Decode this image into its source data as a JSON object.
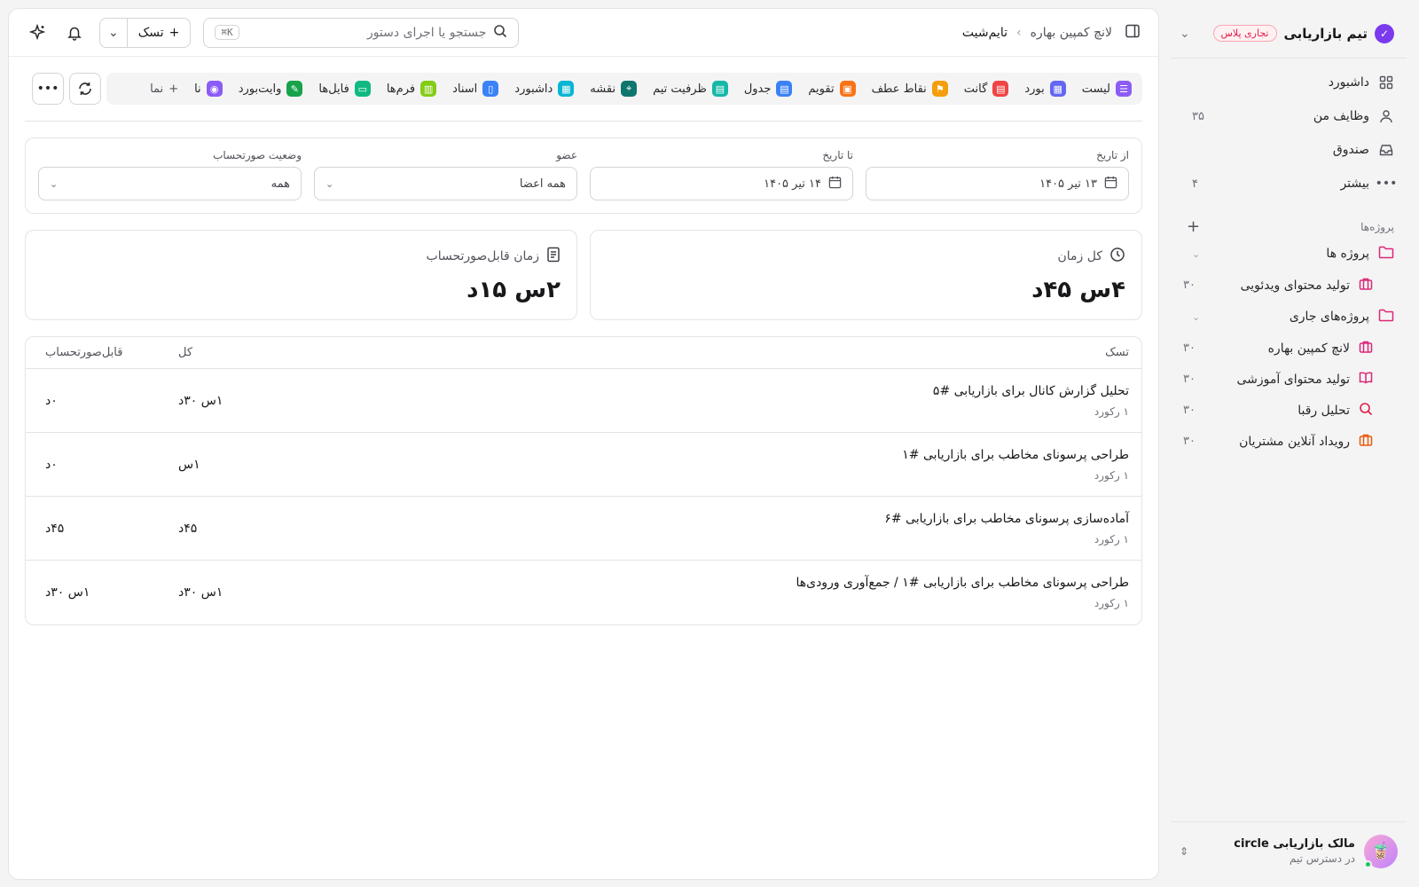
{
  "sidebar": {
    "workspace_name": "تیم بازاریابی",
    "plan_badge": "تجاری پلاس",
    "nav": [
      {
        "label": "داشبورد",
        "count": "",
        "icon": "grid-icon"
      },
      {
        "label": "وظایف من",
        "count": "۳۵",
        "icon": "user-icon"
      },
      {
        "label": "صندوق",
        "count": "",
        "icon": "inbox-icon"
      },
      {
        "label": "بیشتر",
        "count": "۴",
        "icon": "more-icon"
      }
    ],
    "projects_label": "پروژه‌ها",
    "folders": [
      {
        "label": "پروژه ها",
        "projects": [
          {
            "label": "تولید محتوای ویدئویی",
            "count": "۳۰",
            "color": "#db2777"
          }
        ]
      },
      {
        "label": "پروژه‌های جاری",
        "projects": [
          {
            "label": "لانچ کمپین بهاره",
            "count": "۳۰",
            "color": "#db2777"
          },
          {
            "label": "تولید محتوای آموزشی",
            "count": "۳۰",
            "color": "#db2777"
          },
          {
            "label": "تحلیل رقبا",
            "count": "۳۰",
            "color": "#e11d48"
          },
          {
            "label": "رویداد آنلاین مشتریان",
            "count": "۳۰",
            "color": "#ea580c"
          }
        ]
      }
    ],
    "user": {
      "name": "مالک بازاریابی circle",
      "sub": "در دسترس تیم"
    }
  },
  "topbar": {
    "breadcrumb_parent": "لانچ کمپین بهاره",
    "breadcrumb_current": "تایم‌شیت",
    "search_placeholder": "جستجو یا اجرای دستور",
    "search_shortcut": "⌘K",
    "task_button": "تسک"
  },
  "views": [
    {
      "label": "لیست",
      "color": "#8b5cf6"
    },
    {
      "label": "بورد",
      "color": "#6366f1"
    },
    {
      "label": "گانت",
      "color": "#ef4444"
    },
    {
      "label": "نقاط عطف",
      "color": "#f59e0b"
    },
    {
      "label": "تقویم",
      "color": "#f97316"
    },
    {
      "label": "جدول",
      "color": "#3b82f6"
    },
    {
      "label": "ظرفیت تیم",
      "color": "#14b8a6"
    },
    {
      "label": "نقشه",
      "color": "#0f766e"
    },
    {
      "label": "داشبورد",
      "color": "#06b6d4"
    },
    {
      "label": "اسناد",
      "color": "#3b82f6"
    },
    {
      "label": "فرم‌ها",
      "color": "#84cc16"
    },
    {
      "label": "فایل‌ها",
      "color": "#10b981"
    },
    {
      "label": "وایت‌بورد",
      "color": "#16a34a"
    },
    {
      "label": "نا",
      "color": "#8b5cf6"
    }
  ],
  "view_more_label": "نما",
  "filters": {
    "from_label": "از تاریخ",
    "from_value": "۱۳ تیر ۱۴۰۵",
    "to_label": "تا تاریخ",
    "to_value": "۱۴ تیر ۱۴۰۵",
    "member_label": "عضو",
    "member_value": "همه اعضا",
    "invoice_label": "وضعیت صورتحساب",
    "invoice_value": "همه"
  },
  "stats": {
    "total_label": "کل زمان",
    "total_value": "۴س ۴۵د",
    "billable_label": "زمان قابل‌صورتحساب",
    "billable_value": "۲س ۱۵د"
  },
  "table": {
    "headers": {
      "task": "تسک",
      "total": "کل",
      "billable": "قابل‌صورتحساب"
    },
    "rows": [
      {
        "title": "تحلیل گزارش کانال برای بازاریابی #۵",
        "sub": "۱ رکورد",
        "total": "۱س ۳۰د",
        "billable": "۰د"
      },
      {
        "title": "طراحی پرسونای مخاطب برای بازاریابی #۱",
        "sub": "۱ رکورد",
        "total": "۱س",
        "billable": "۰د"
      },
      {
        "title": "آماده‌سازی پرسونای مخاطب برای بازاریابی #۶",
        "sub": "۱ رکورد",
        "total": "۴۵د",
        "billable": "۴۵د"
      },
      {
        "title": "طراحی پرسونای مخاطب برای بازاریابی #۱ / جمع‌آوری ورودی‌ها",
        "sub": "۱ رکورد",
        "total": "۱س ۳۰د",
        "billable": "۱س ۳۰د"
      }
    ]
  }
}
